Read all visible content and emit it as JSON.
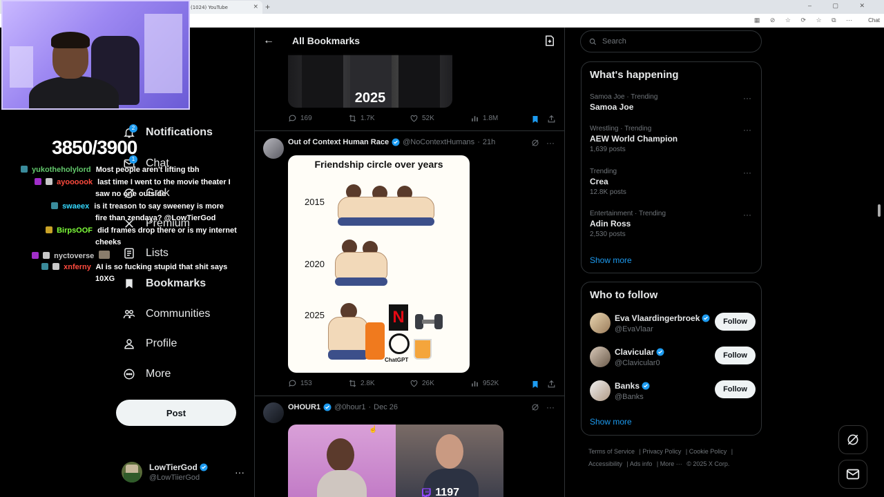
{
  "browser": {
    "tab_title": "(1024) YouTube",
    "tab_close": "×",
    "new_tab": "+",
    "window_controls": "– ▢ ✕",
    "address_icons": "▦ ⊘ ☆ ⟳ ☆ ⧉ ⋯",
    "chat_label": "Chat"
  },
  "stream_overlay": {
    "viewer_count": "3850/3900",
    "chat": [
      {
        "user": "yukotheholylord",
        "user_color": "#62c76b",
        "message": "Most people aren't lifting tbh"
      },
      {
        "user": "ayoooook",
        "user_color": "#ff4b3e",
        "message": "last time I went to the movie theater I"
      },
      {
        "user": "",
        "user_color": "#ffffff",
        "message": "saw no one outside"
      },
      {
        "user": "swaeex",
        "user_color": "#35d9ff",
        "message": "is it treason to say sweeney is more"
      },
      {
        "user": "",
        "user_color": "#ffffff",
        "message": "fire than zendaya? @LowTierGod"
      },
      {
        "user": "BirpsOOF",
        "user_color": "#7fff3a",
        "message": "did frames drop there or is my internet"
      },
      {
        "user": "",
        "user_color": "#ffffff",
        "message": "cheeks"
      },
      {
        "user": "nyctoverse",
        "user_color": "#c9c9c9",
        "message": ""
      },
      {
        "user": "xnferny",
        "user_color": "#ff4b3e",
        "message": "AI is so fucking stupid that shit says"
      },
      {
        "user": "",
        "user_color": "#ffffff",
        "message": "10XG"
      }
    ]
  },
  "nav": {
    "notifications": "Notifications",
    "notifications_badge": "2",
    "chat": "Chat",
    "chat_badge": "1",
    "grok": "Grok",
    "premium": "Premium",
    "lists": "Lists",
    "bookmarks": "Bookmarks",
    "communities": "Communities",
    "profile": "Profile",
    "more": "More",
    "post": "Post"
  },
  "account": {
    "name": "LowTierGod",
    "handle": "@LowTiierGod",
    "more": "···"
  },
  "main": {
    "title": "All Bookmarks",
    "back": "←",
    "tweets": [
      {
        "image_caption": "2025",
        "replies": "169",
        "reposts": "1.7K",
        "likes": "52K",
        "views": "1.8M"
      },
      {
        "name": "Out of Context Human Race",
        "handle": "@NoContextHumans",
        "time": "21h",
        "meme_title": "Friendship circle over years",
        "years": [
          "2015",
          "2020",
          "2025"
        ],
        "chatgpt_label": "ChatGPT",
        "replies": "153",
        "reposts": "2.8K",
        "likes": "26K",
        "views": "952K"
      },
      {
        "name": "OHOUR1",
        "handle": "@0hour1",
        "time": "Dec 26",
        "overlay_count": "1197"
      }
    ]
  },
  "sidebar": {
    "search_placeholder": "Search",
    "happening_title": "What's happening",
    "trends": [
      {
        "category": "Samoa Joe · Trending",
        "name": "Samoa Joe",
        "count": ""
      },
      {
        "category": "Wrestling · Trending",
        "name": "AEW World Champion",
        "count": "1,639 posts"
      },
      {
        "category": "Trending",
        "name": "Crea",
        "count": "12.8K posts"
      },
      {
        "category": "Entertainment · Trending",
        "name": "Adin Ross",
        "count": "2,530 posts"
      }
    ],
    "trend_more": "···",
    "show_more": "Show more",
    "who_to_follow_title": "Who to follow",
    "follow": [
      {
        "name": "Eva Vlaardingerbroek",
        "handle": "@EvaVlaar",
        "button": "Follow"
      },
      {
        "name": "Clavicular",
        "handle": "@Clavicular0",
        "button": "Follow"
      },
      {
        "name": "Banks",
        "handle": "@Banks",
        "button": "Follow"
      }
    ],
    "show_more_follow": "Show more",
    "footer": {
      "terms": "Terms of Service",
      "privacy": "Privacy Policy",
      "cookie": "Cookie Policy",
      "accessibility": "Accessibility",
      "ads": "Ads info",
      "more": "More ···",
      "copyright": "© 2025 X Corp."
    }
  },
  "colors": {
    "accent": "#1d9bf0",
    "bookmark": "#1d9bf0",
    "netflix": "#e50914",
    "twitch": "#9146ff"
  }
}
